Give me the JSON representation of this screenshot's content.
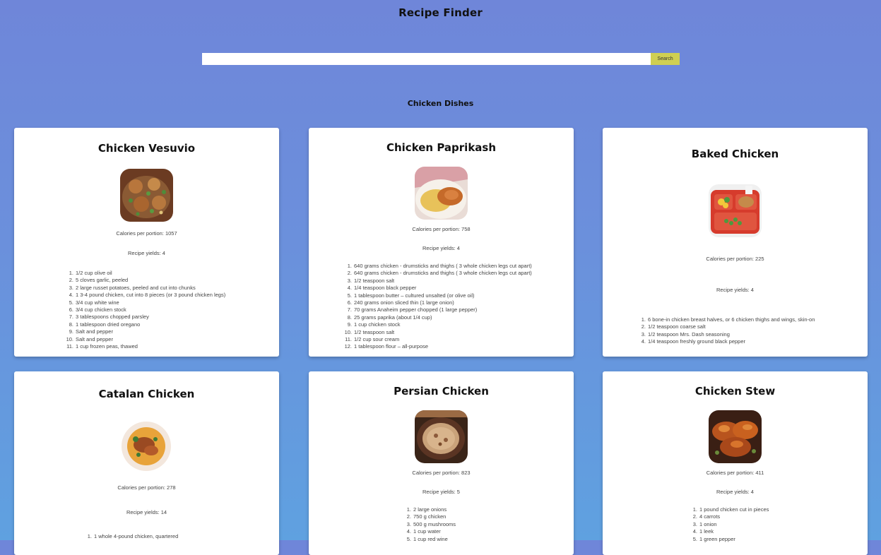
{
  "app": {
    "title": "Recipe Finder"
  },
  "search": {
    "placeholder": "",
    "value": "",
    "button_label": "Search"
  },
  "section": {
    "title": "Chicken Dishes"
  },
  "recipes": [
    {
      "name": "Chicken Vesuvio",
      "calories": "Calories per portion: 1057",
      "yields": "Recipe yields: 4",
      "ingredients": [
        "1/2 cup olive oil",
        "5 cloves garlic, peeled",
        "2 large russet potatoes, peeled and cut into chunks",
        "1 3-4 pound chicken, cut into 8 pieces (or 3 pound chicken legs)",
        "3/4 cup white wine",
        "3/4 cup chicken stock",
        "3 tablespoons chopped parsley",
        "1 tablespoon dried oregano",
        "Salt and pepper",
        "Salt and pepper",
        "1 cup frozen peas, thawed"
      ]
    },
    {
      "name": "Chicken Paprikash",
      "calories": "Calories per portion: 758",
      "yields": "Recipe yields: 4",
      "ingredients": [
        "640 grams chicken - drumsticks and thighs ( 3 whole chicken legs cut apart)",
        "640 grams chicken - drumsticks and thighs ( 3 whole chicken legs cut apart)",
        "1/2 teaspoon salt",
        "1/4 teaspoon black pepper",
        "1 tablespoon butter – cultured unsalted (or olive oil)",
        "240 grams onion sliced thin (1 large onion)",
        "70 grams Anaheim pepper chopped (1 large pepper)",
        "25 grams paprika (about 1/4 cup)",
        "1 cup chicken stock",
        "1/2 teaspoon salt",
        "1/2 cup sour cream",
        "1 tablespoon flour – all-purpose"
      ]
    },
    {
      "name": "Baked Chicken",
      "calories": "Calories per portion: 225",
      "yields": "Recipe yields: 4",
      "ingredients": [
        "6 bone-in chicken breast halves, or 6 chicken thighs and wings, skin-on",
        "1/2 teaspoon coarse salt",
        "1/2 teaspoon Mrs. Dash seasoning",
        "1/4 teaspoon freshly ground black pepper"
      ]
    },
    {
      "name": "Catalan Chicken",
      "calories": "Calories per portion: 278",
      "yields": "Recipe yields: 14",
      "ingredients": [
        "1 whole 4-pound chicken, quartered"
      ]
    },
    {
      "name": "Persian Chicken",
      "calories": "Calories per portion: 823",
      "yields": "Recipe yields: 5",
      "ingredients": [
        "2 large onions",
        "750 g chicken",
        "500 g mushrooms",
        "1 cup water",
        "1 cup red wine"
      ]
    },
    {
      "name": "Chicken Stew",
      "calories": "Calories per portion: 411",
      "yields": "Recipe yields: 4",
      "ingredients": [
        "1 pound chicken cut in pieces",
        "4 carrots",
        "1 onion",
        "1 leek",
        "1 green pepper"
      ]
    }
  ]
}
